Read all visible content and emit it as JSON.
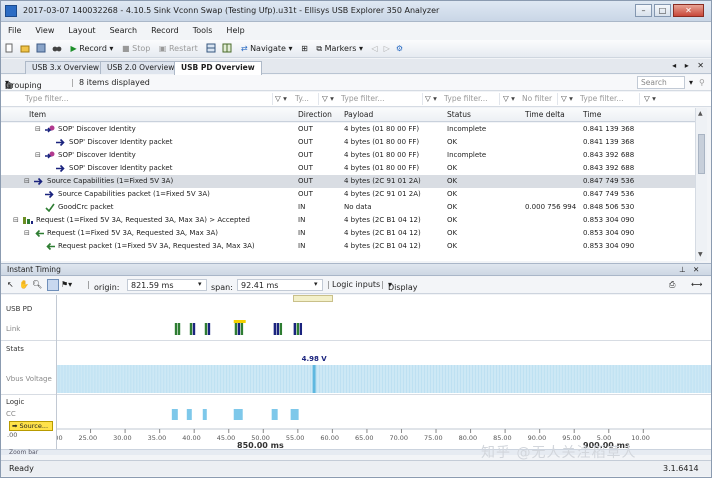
{
  "window": {
    "title": "2017-03-07 140032268 - 4.10.5 Sink Vconn Swap (Testing Ufp).u31t - Ellisys USB Explorer 350 Analyzer",
    "controls": [
      "–",
      "□",
      "✕"
    ]
  },
  "menu": [
    "File",
    "View",
    "Layout",
    "Search",
    "Record",
    "Tools",
    "Help"
  ],
  "toolbar": {
    "record": "Record",
    "stop": "Stop",
    "restart": "Restart",
    "navigate": "Navigate",
    "markers": "Markers"
  },
  "tabs": [
    "USB 3.x Overview",
    "USB 2.0 Overview",
    "USB PD Overview"
  ],
  "tab_nav": "◂ ▸ ✕",
  "grouping": {
    "label": "Grouping",
    "count": "8 items displayed",
    "search_placeholder": "Search"
  },
  "filters": {
    "type": "Type filter...",
    "ty": "Ty...",
    "payload": "Type filter...",
    "status": "Type filter...",
    "delta": "No filter",
    "time": "Type filter..."
  },
  "columns": {
    "item": "Item",
    "direction": "Direction",
    "payload": "Payload",
    "status": "Status",
    "delta": "Time delta",
    "time": "Time"
  },
  "rows": [
    {
      "item": "SOP' Discover Identity",
      "dir": "OUT",
      "payload": "4 bytes (01 80 00 FF)",
      "status": "Incomplete",
      "delta": "",
      "time": "0.841 139 368",
      "level": 2,
      "toggle": "⊟",
      "icon": "arrow-gear"
    },
    {
      "item": "SOP' Discover Identity packet",
      "dir": "OUT",
      "payload": "4 bytes (01 80 00 FF)",
      "status": "OK",
      "delta": "",
      "time": "0.841 139 368",
      "level": 3,
      "toggle": "",
      "icon": "arrow-right"
    },
    {
      "item": "SOP' Discover Identity",
      "dir": "OUT",
      "payload": "4 bytes (01 80 00 FF)",
      "status": "Incomplete",
      "delta": "",
      "time": "0.843 392 688",
      "level": 2,
      "toggle": "⊟",
      "icon": "arrow-gear"
    },
    {
      "item": "SOP' Discover Identity packet",
      "dir": "OUT",
      "payload": "4 bytes (01 80 00 FF)",
      "status": "OK",
      "delta": "",
      "time": "0.843 392 688",
      "level": 3,
      "toggle": "",
      "icon": "arrow-right"
    },
    {
      "item": "Source Capabilities (1=Fixed 5V 3A)",
      "dir": "OUT",
      "payload": "4 bytes (2C 91 01 2A)",
      "status": "OK",
      "delta": "",
      "time": "0.847 749 536",
      "level": 1,
      "toggle": "⊟",
      "icon": "arrow-right",
      "selected": true
    },
    {
      "item": "Source Capabilities packet (1=Fixed 5V 3A)",
      "dir": "OUT",
      "payload": "4 bytes (2C 91 01 2A)",
      "status": "OK",
      "delta": "",
      "time": "0.847 749 536",
      "level": 2,
      "toggle": "",
      "icon": "arrow-right"
    },
    {
      "item": "GoodCrc packet",
      "dir": "IN",
      "payload": "No data",
      "status": "OK",
      "delta": "0.000 756 994",
      "time": "0.848 506 530",
      "level": 2,
      "toggle": "",
      "icon": "check"
    },
    {
      "item": "Request (1=Fixed 5V 3A, Requested 3A, Max 3A) > Accepted",
      "dir": "IN",
      "payload": "4 bytes (2C B1 04 12)",
      "status": "OK",
      "delta": "",
      "time": "0.853 304 090",
      "level": 0,
      "toggle": "⊟",
      "icon": "transaction"
    },
    {
      "item": "Request (1=Fixed 5V 3A, Requested 3A, Max 3A)",
      "dir": "IN",
      "payload": "4 bytes (2C B1 04 12)",
      "status": "OK",
      "delta": "",
      "time": "0.853 304 090",
      "level": 1,
      "toggle": "⊟",
      "icon": "arrow-left"
    },
    {
      "item": "Request packet (1=Fixed 5V 3A, Requested 3A, Max 3A)",
      "dir": "IN",
      "payload": "4 bytes (2C B1 04 12)",
      "status": "OK",
      "delta": "",
      "time": "0.853 304 090",
      "level": 2,
      "toggle": "",
      "icon": "arrow-left"
    }
  ],
  "instant_timing": {
    "title": "Instant Timing",
    "origin_label": "origin:",
    "origin_value": "821.59 ms",
    "span_label": "span:",
    "span_value": "92.41 ms",
    "logic_inputs": "Logic inputs",
    "display": "Display"
  },
  "lanes": {
    "usb_pd": "USB PD",
    "link": "Link",
    "stats": "Stats",
    "vbus": "Vbus Voltage",
    "logic": "Logic",
    "cc": "CC",
    "source_tag": "Source..."
  },
  "vbus_readout": "4.98 V",
  "axis": {
    "ticks": [
      "20.00",
      "25.00",
      "30.00",
      "35.00",
      "40.00",
      "45.00",
      "50.00",
      "55.00",
      "60.00",
      "65.00",
      "70.00",
      "75.00",
      "80.00",
      "85.00",
      "90.00",
      "95.00",
      "5.00",
      "10.00"
    ],
    "left_stub": ".00",
    "center_label": "850.00 ms",
    "right_label": "900.00 ms",
    "zoom_bar": "Zoom bar"
  },
  "status": {
    "left": "Ready",
    "version": "3.1.6414"
  },
  "watermark": "知乎 @无人关注稻草人",
  "colors": {
    "selected_row": "#d9dde3",
    "link_green": "#2e7d32",
    "link_navy": "#1a237e",
    "link_yellow": "#f4d000",
    "vbus_fill": "#cde8f5",
    "vbus_marker": "#5fb8e0",
    "cc_blue": "#7ec8ea",
    "source_tag": "#ffe24a"
  }
}
